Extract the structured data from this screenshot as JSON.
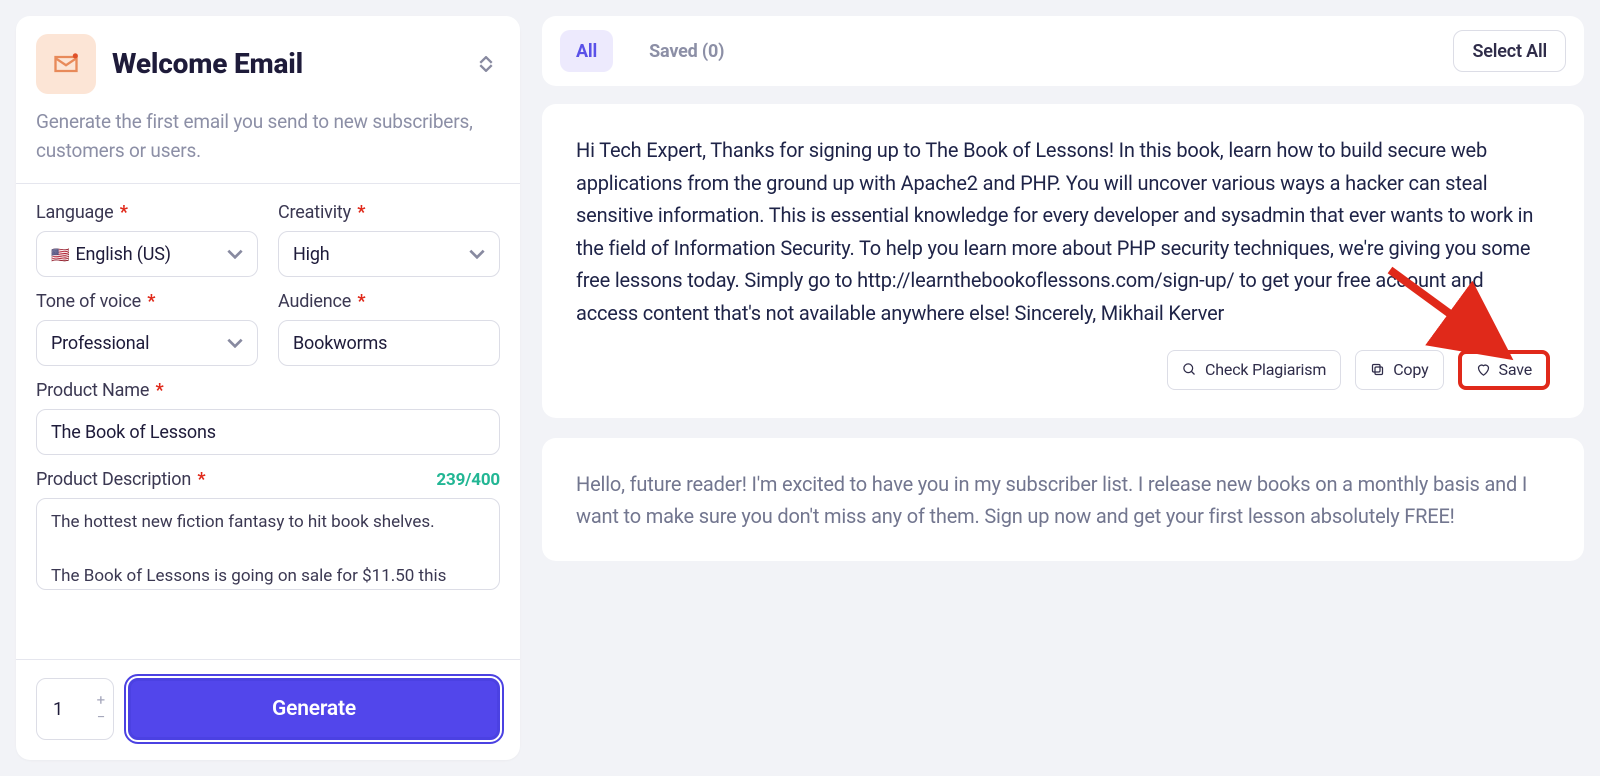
{
  "tool": {
    "title": "Welcome Email",
    "subtitle": "Generate the first email you send to new subscribers, customers or users."
  },
  "form": {
    "language": {
      "label": "Language",
      "value": "English (US)",
      "flag": "🇺🇸"
    },
    "creativity": {
      "label": "Creativity",
      "value": "High"
    },
    "tone": {
      "label": "Tone of voice",
      "value": "Professional"
    },
    "audience": {
      "label": "Audience",
      "value": "Bookworms"
    },
    "product_name": {
      "label": "Product Name",
      "value": "The Book of Lessons"
    },
    "product_desc": {
      "label": "Product Description",
      "counter": "239/400",
      "value": "The hottest new fiction fantasy to hit book shelves.\n\nThe Book of Lessons is going on sale for $11.50 this"
    },
    "quantity": "1",
    "generate_label": "Generate"
  },
  "tabs": {
    "all": "All",
    "saved": "Saved (0)",
    "select_all": "Select All"
  },
  "actions": {
    "check": "Check Plagiarism",
    "copy": "Copy",
    "save": "Save"
  },
  "results": [
    {
      "text": "Hi Tech Expert, Thanks for signing up to The Book of Lessons! In this book, learn how to build secure web applications from the ground up with Apache2 and PHP. You will uncover various ways a hacker can steal sensitive information. This is essential knowledge for every developer and sysadmin that ever wants to work in the field of Information Security. To help you learn more about PHP security techniques, we're giving you some free lessons today. Simply go to http://learnthebookoflessons.com/sign-up/ to get your free account and access content that's not available anywhere else! Sincerely, Mikhail Kerver"
    },
    {
      "text": "Hello, future reader! I'm excited to have you in my subscriber list. I release new books on a monthly basis and I want to make sure you don't miss any of them. Sign up now and get your first lesson absolutely FREE!"
    }
  ]
}
